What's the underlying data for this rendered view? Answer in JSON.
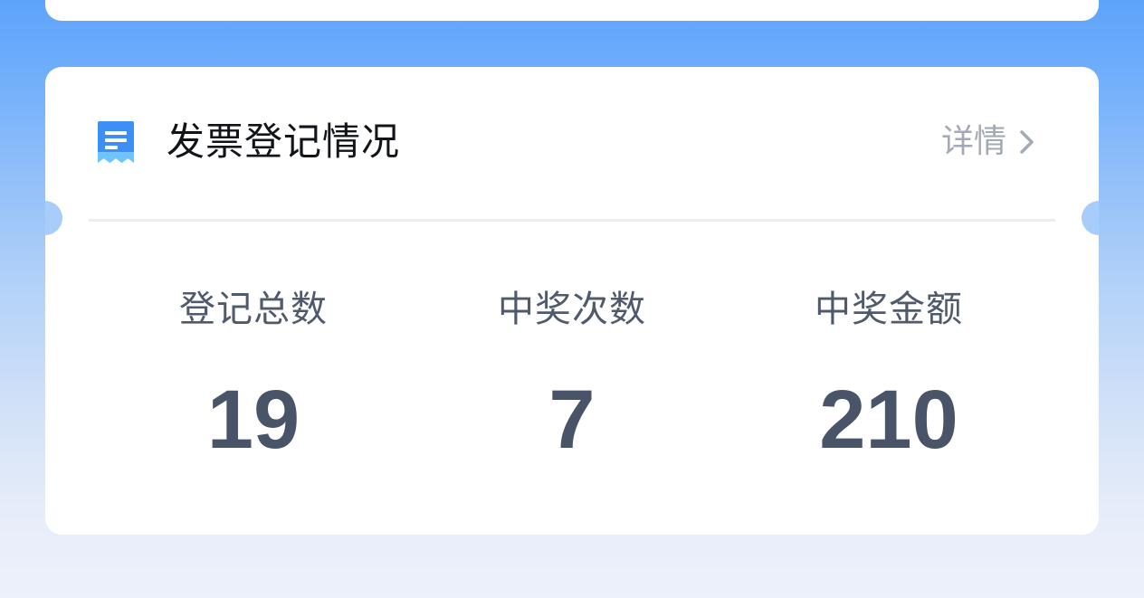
{
  "card": {
    "title": "发票登记情况",
    "icon": "invoice-receipt-icon",
    "detail_label": "详情",
    "detail_icon": "chevron-right-icon"
  },
  "stats": [
    {
      "label": "登记总数",
      "value": "19"
    },
    {
      "label": "中奖次数",
      "value": "7"
    },
    {
      "label": "中奖金额",
      "value": "210"
    }
  ],
  "colors": {
    "accent": "#3d8ef5",
    "title": "#111418",
    "label": "#505a6b",
    "value": "#4a5468",
    "muted": "#a3a9b5"
  }
}
